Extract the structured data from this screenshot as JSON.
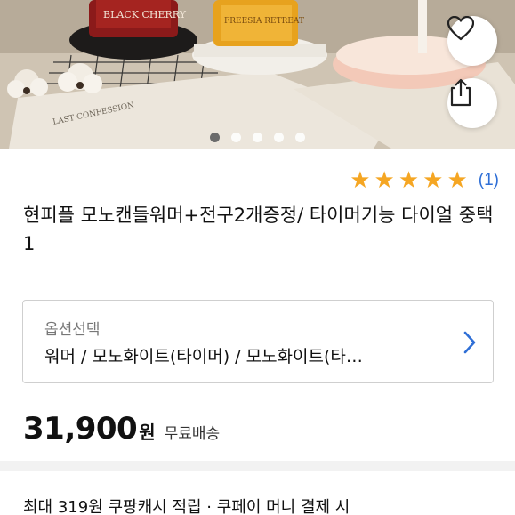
{
  "hero": {
    "jar_labels": [
      "BLACK CHERRY",
      "FREESIA RETREAT"
    ],
    "card_text": "LAST CONFESSION",
    "carousel": {
      "total": 5,
      "active": 1
    },
    "heart_icon": "heart-outline-icon",
    "share_icon": "share-icon"
  },
  "rating": {
    "stars": 5,
    "count_label": "(1)",
    "star_color": "#f5a623",
    "count_color": "#2f6fd6"
  },
  "product": {
    "title": "현피플 모노캔들워머+전구2개증정/ 타이머기능 다이얼 중택1"
  },
  "option": {
    "label": "옵션선택",
    "value": "워머 / 모노화이트(타이머) / 모노화이트(타…",
    "chevron_color": "#2f6fd6"
  },
  "price": {
    "amount": "31,900",
    "unit": "원",
    "shipping": "무료배송"
  },
  "cash_note": "최대 319원 쿠팡캐시 적립 · 쿠페이 머니 결제 시"
}
